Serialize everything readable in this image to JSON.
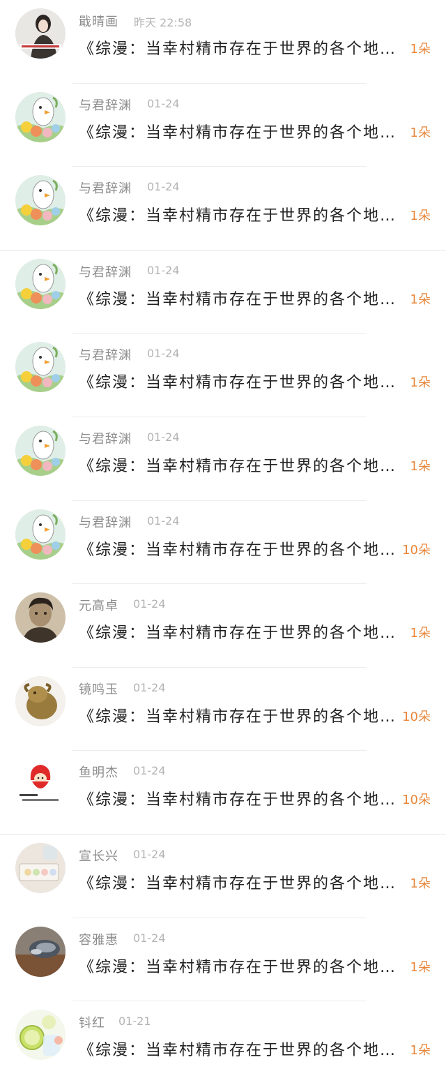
{
  "gift_list": {
    "items": [
      {
        "name": "戢晴画",
        "time": "昨天 22:58",
        "title": "《综漫：当幸村精市存在于世界的各个地…",
        "count": "1朵",
        "avatar": "portrait-woman-caption"
      },
      {
        "name": "与君辞渊",
        "time": "01-24",
        "title": "《综漫：当幸村精市存在于世界的各个地…",
        "count": "1朵",
        "avatar": "cartoon-birds"
      },
      {
        "name": "与君辞渊",
        "time": "01-24",
        "title": "《综漫：当幸村精市存在于世界的各个地…",
        "count": "1朵",
        "avatar": "cartoon-birds"
      },
      {
        "name": "与君辞渊",
        "time": "01-24",
        "title": "《综漫：当幸村精市存在于世界的各个地…",
        "count": "1朵",
        "avatar": "cartoon-birds"
      },
      {
        "name": "与君辞渊",
        "time": "01-24",
        "title": "《综漫：当幸村精市存在于世界的各个地…",
        "count": "1朵",
        "avatar": "cartoon-birds"
      },
      {
        "name": "与君辞渊",
        "time": "01-24",
        "title": "《综漫：当幸村精市存在于世界的各个地…",
        "count": "1朵",
        "avatar": "cartoon-birds"
      },
      {
        "name": "与君辞渊",
        "time": "01-24",
        "title": "《综漫：当幸村精市存在于世界的各个地…",
        "count": "10朵",
        "avatar": "cartoon-birds"
      },
      {
        "name": "元高卓",
        "time": "01-24",
        "title": "《综漫：当幸村精市存在于世界的各个地…",
        "count": "1朵",
        "avatar": "portrait-man-sepia"
      },
      {
        "name": "镜鸣玉",
        "time": "01-24",
        "title": "《综漫：当幸村精市存在于世界的各个地…",
        "count": "10朵",
        "avatar": "carved-figurine"
      },
      {
        "name": "鱼明杰",
        "time": "01-24",
        "title": "《综漫：当幸村精市存在于世界的各个地…",
        "count": "10朵",
        "avatar": "red-hood-cartoon"
      },
      {
        "name": "宣长兴",
        "time": "01-24",
        "title": "《综漫：当幸村精市存在于世界的各个地…",
        "count": "1朵",
        "avatar": "macarons-box"
      },
      {
        "name": "容雅惠",
        "time": "01-24",
        "title": "《综漫：当幸村精市存在于世界的各个地…",
        "count": "1朵",
        "avatar": "shell-blur"
      },
      {
        "name": "钭红",
        "time": "01-21",
        "title": "《综漫：当幸村精市存在于世界的各个地…",
        "count": "1朵",
        "avatar": "lemon-drink"
      }
    ]
  },
  "colors": {
    "name": "#8b8b8b",
    "time": "#b4b4b4",
    "title": "#222222",
    "count": "#e8863a",
    "divider": "#ececec"
  }
}
